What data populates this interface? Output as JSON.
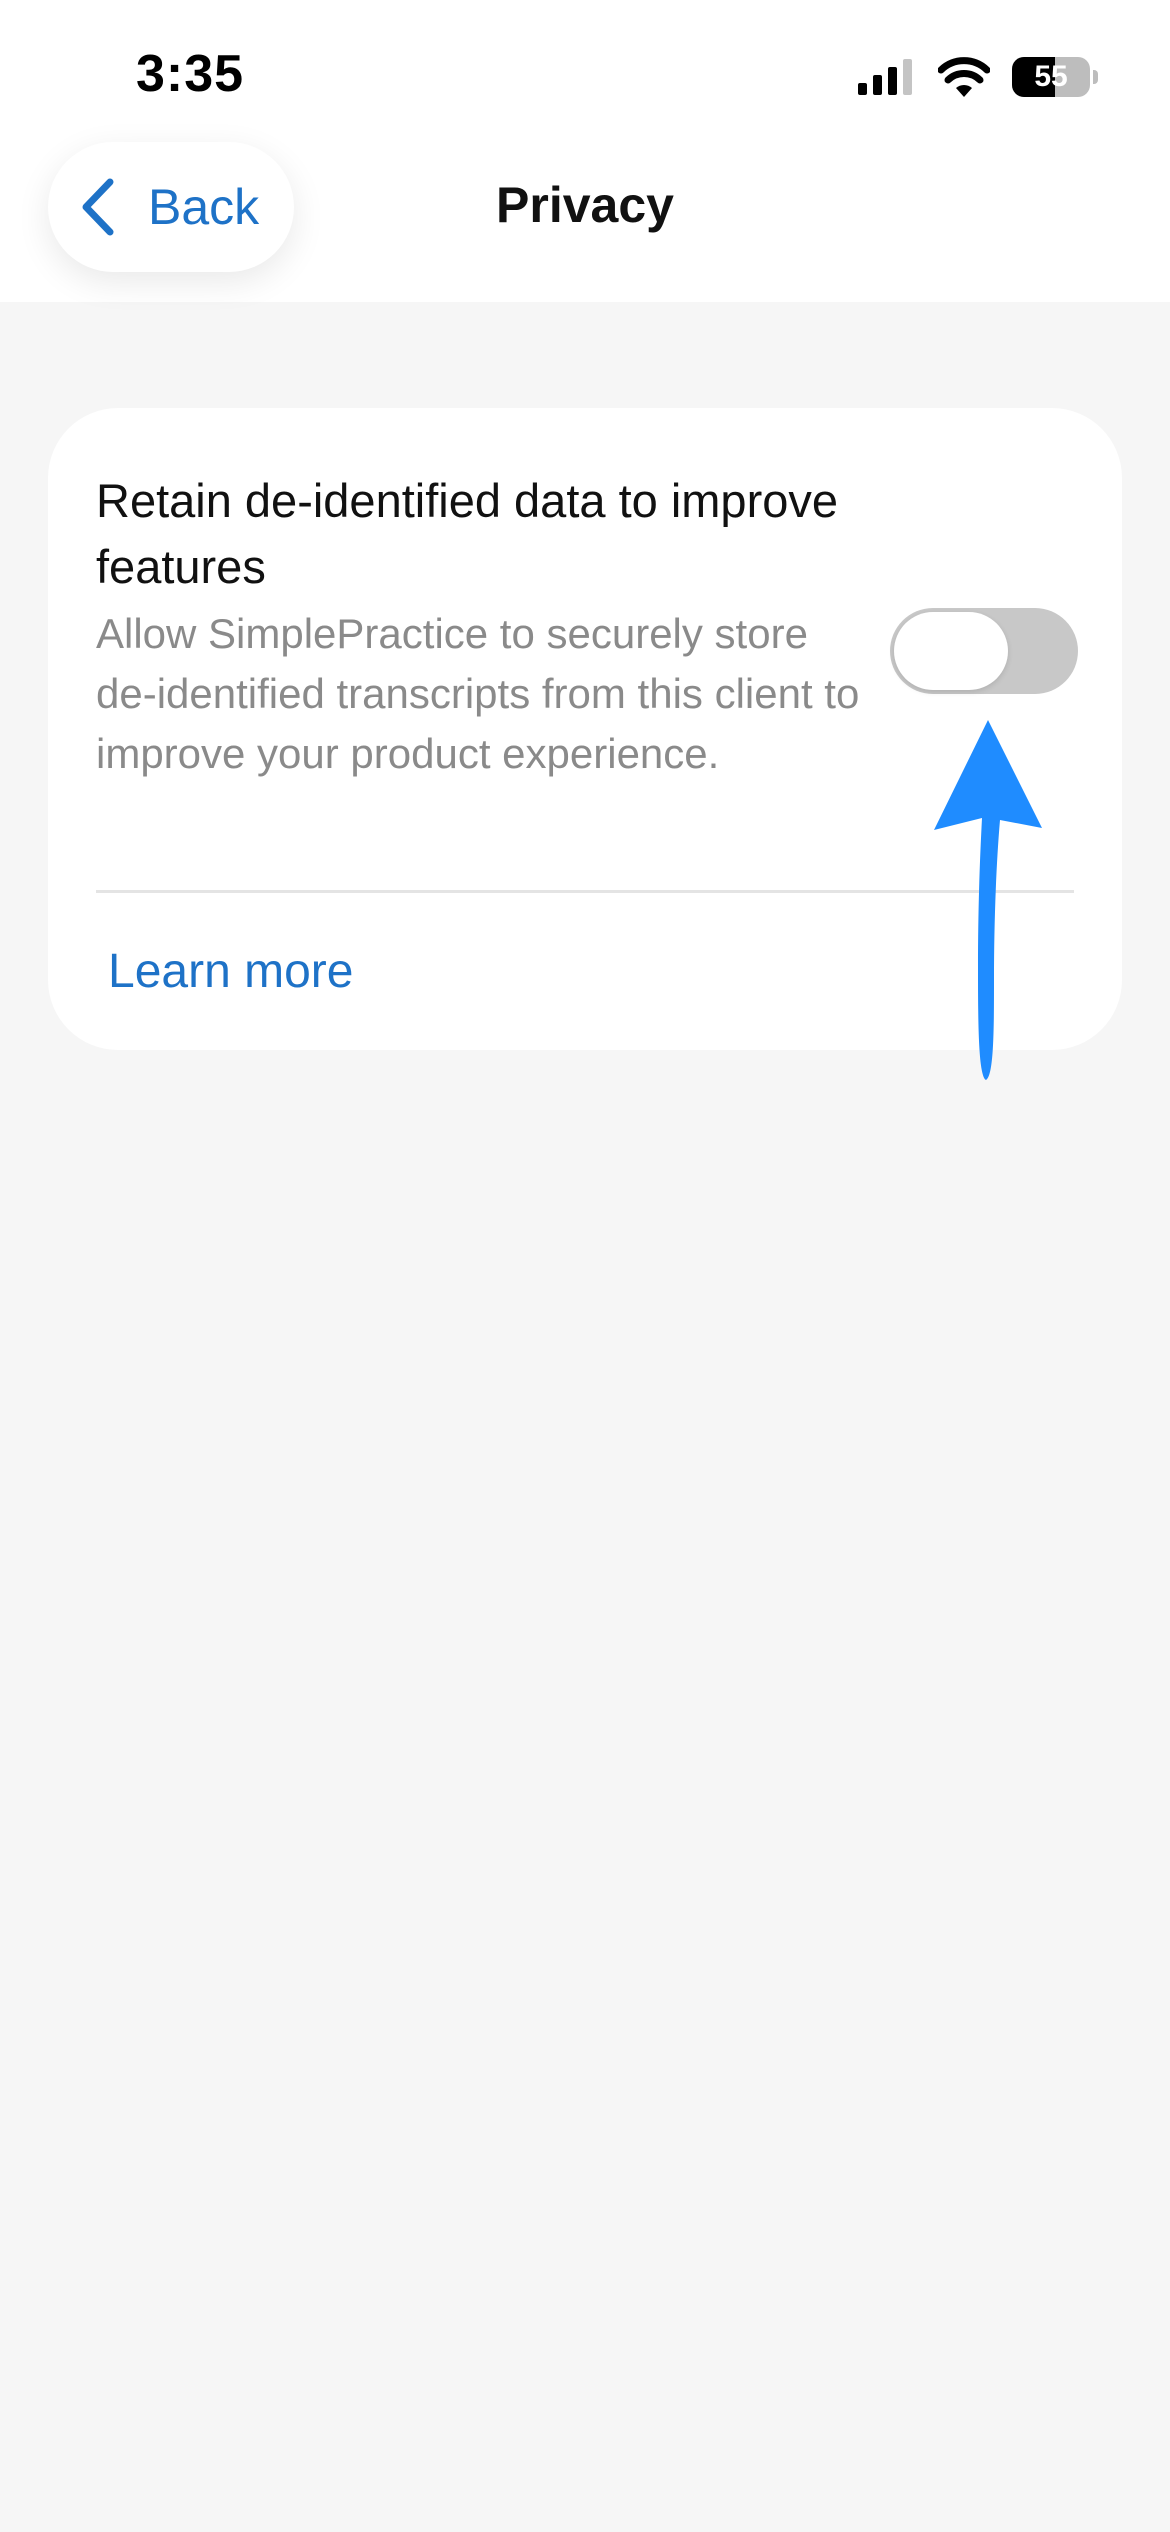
{
  "status_bar": {
    "time": "3:35",
    "battery_level": "55",
    "battery_fraction": 0.55,
    "icons": [
      "cellular-signal-icon",
      "wifi-icon",
      "battery-icon"
    ]
  },
  "nav": {
    "back_label": "Back",
    "title": "Privacy"
  },
  "setting": {
    "title": "Retain de-identified data to improve features",
    "description": "Allow SimplePractice to securely store de-identified transcripts from this client to improve your product experience.",
    "toggle_on": false,
    "learn_more": "Learn more"
  },
  "colors": {
    "accent": "#1e72c7",
    "toggle_off": "#c8c8c8",
    "annotation_arrow": "#1f8cff",
    "background": "#f6f6f6"
  }
}
